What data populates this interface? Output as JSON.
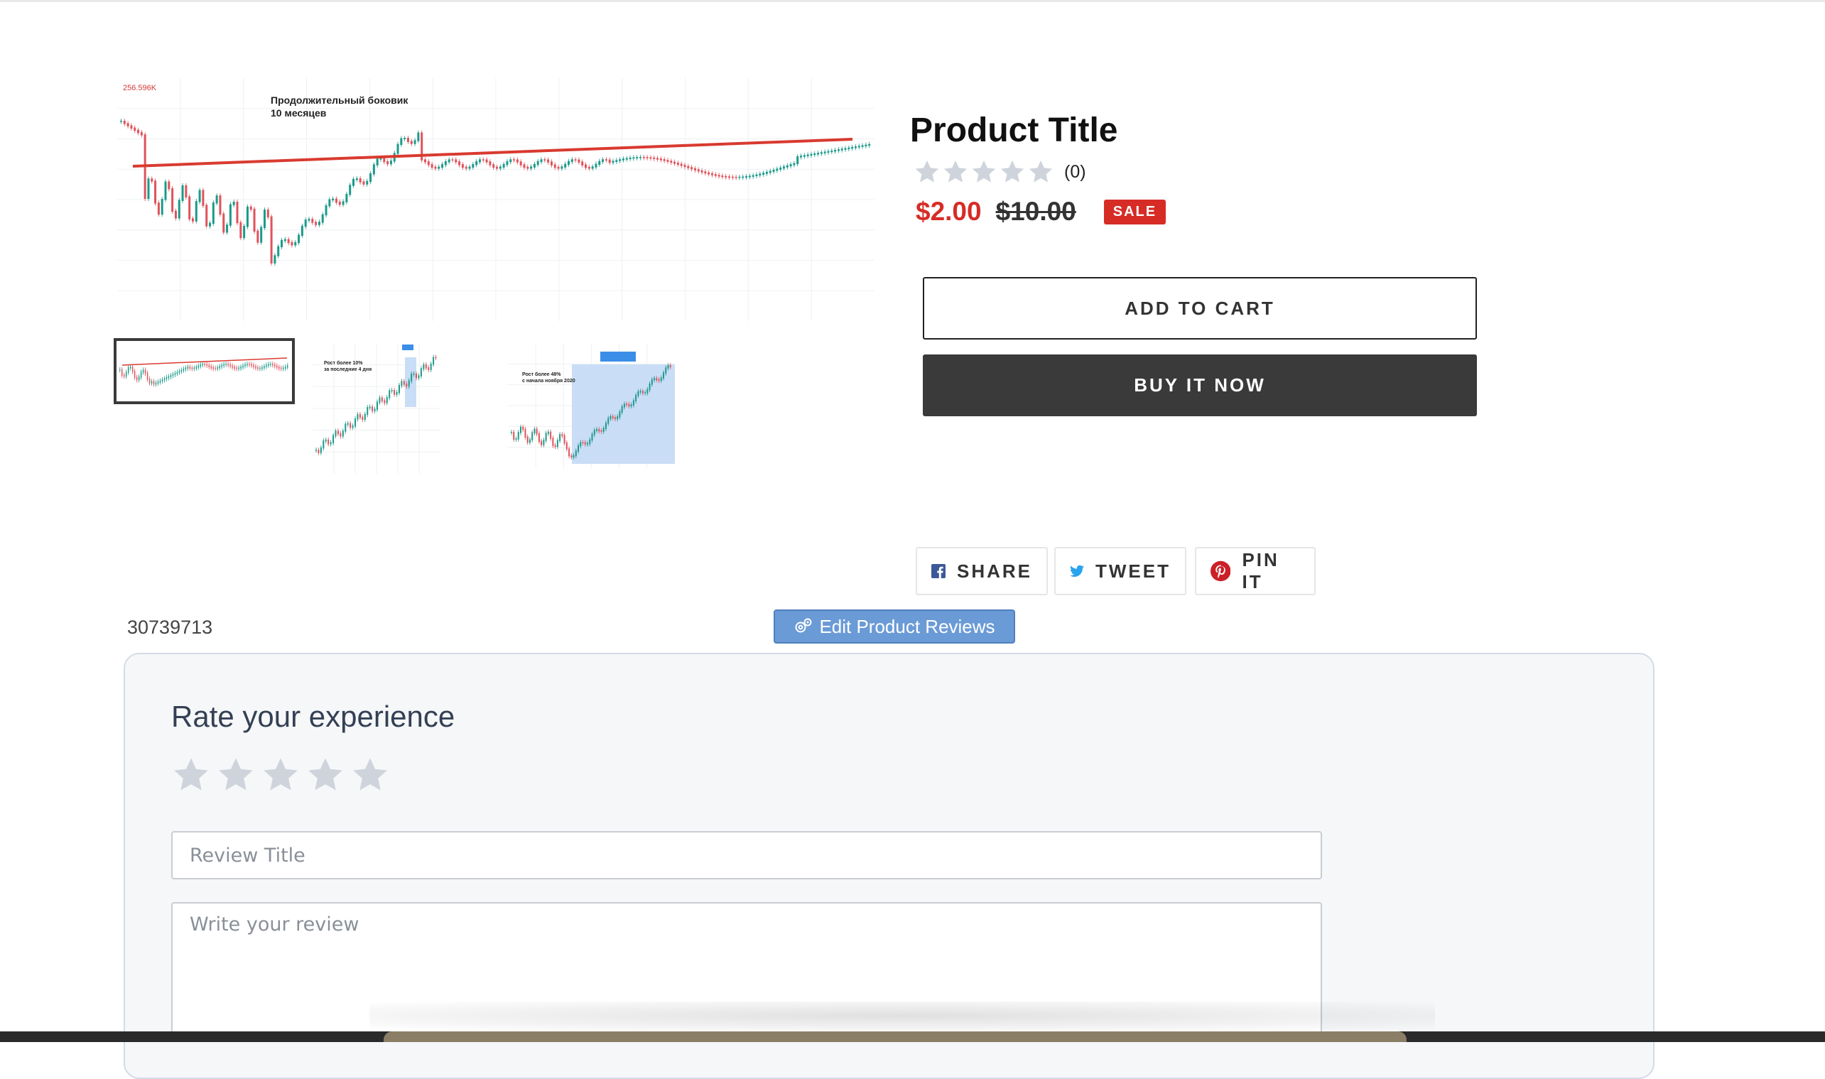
{
  "gallery": {
    "main_price_tag": "256.596K",
    "main_caption_line1": "Продолжительный боковик",
    "main_caption_line2": "10 месяцев",
    "thumb2_caption_line1": "Рост более 10%",
    "thumb2_caption_line2": "за последние 4 дня",
    "thumb3_caption_line1": "Рост более 48%",
    "thumb3_caption_line2": "с начала ноября 2020"
  },
  "product": {
    "title": "Product Title",
    "rating_count": "(0)",
    "sale_price": "$2.00",
    "regular_price": "$10.00",
    "sale_badge": "SALE"
  },
  "actions": {
    "add_to_cart": "ADD TO CART",
    "buy_now": "BUY IT NOW"
  },
  "share": {
    "facebook": "SHARE",
    "twitter": "TWEET",
    "pinterest": "PIN IT"
  },
  "product_id": "30739713",
  "edit_reviews": "Edit Product Reviews",
  "review_form": {
    "heading": "Rate your experience",
    "title_placeholder": "Review Title",
    "body_placeholder": "Write your review"
  },
  "colors": {
    "sale": "#d72c26",
    "dark_button": "#3a3a3a",
    "edit_button": "#6b9bd6",
    "panel_bg": "#f6f7f9",
    "star_empty": "#cfd4dc",
    "trend_line": "#d93a30",
    "candle_up": "#1b9a8a",
    "candle_down": "#e0525a"
  },
  "icons": {
    "star": "star-icon",
    "facebook": "facebook-icon",
    "twitter": "twitter-icon",
    "pinterest": "pinterest-icon",
    "edit": "gear-icon"
  }
}
